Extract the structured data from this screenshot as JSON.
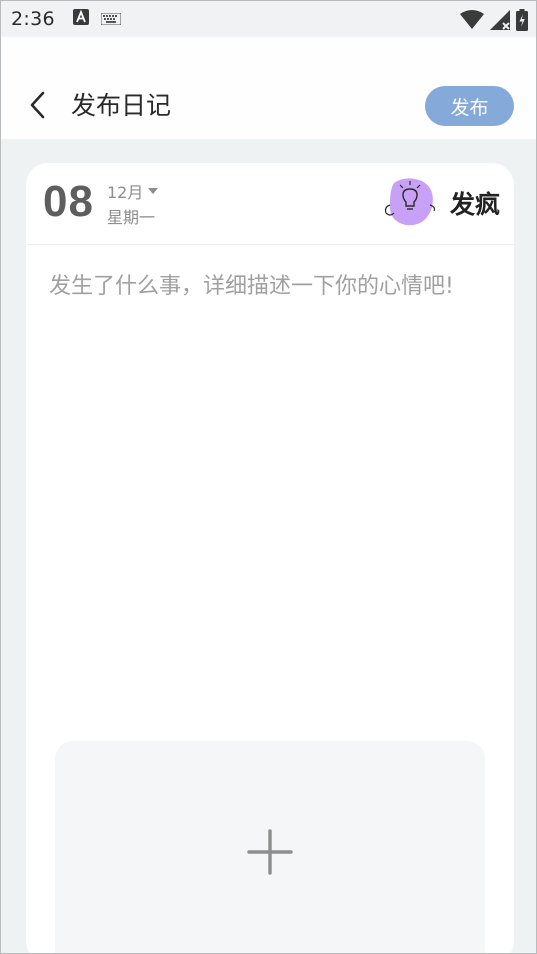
{
  "status_bar": {
    "time": "2:36",
    "icons": [
      "font-a-icon",
      "keyboard-icon",
      "wifi-icon",
      "signal-icon",
      "battery-icon"
    ]
  },
  "header": {
    "title": "发布日记",
    "publish_label": "发布"
  },
  "entry": {
    "day": "08",
    "month": "12月",
    "weekday": "星期一",
    "mood_label": "发疯",
    "mood_icon": "lightbulb-mood-icon",
    "placeholder": "发生了什么事，详细描述一下你的心情吧!"
  },
  "colors": {
    "accent": "#85a9d9",
    "mood_blob": "#c8a0f6",
    "background": "#eef2f3"
  }
}
